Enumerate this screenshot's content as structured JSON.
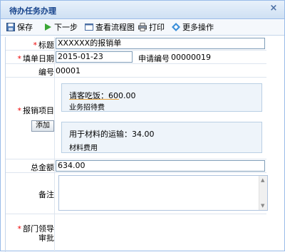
{
  "window": {
    "title": "待办任务办理",
    "close_glyph": "×"
  },
  "toolbar": {
    "save": "保存",
    "next": "下一步",
    "flowchart": "查看流程图",
    "print": "打印",
    "more": "更多操作"
  },
  "form": {
    "title_label": "标题",
    "title_value": "XXXXXX的报销单",
    "date_label": "填单日期",
    "date_value": "2015-01-23",
    "apply_no_label": "申请编号",
    "apply_no_value": "00000019",
    "no_label": "编号",
    "no_value": "00001",
    "items_label": "报销项目",
    "add_button": "添加",
    "items": [
      {
        "amount": "请客吃饭：600.00",
        "category": "业务招待费"
      },
      {
        "amount": "用于材料的运输：34.00",
        "category": "材料费用"
      }
    ],
    "total_label": "总金额",
    "total_value": "634.00",
    "remark_label": "备注",
    "approval_label_1": "部门领导",
    "approval_label_2": "审批"
  },
  "colors": {
    "title_text": "#15428b",
    "border": "#99bbe8",
    "required": "#ee0000"
  }
}
